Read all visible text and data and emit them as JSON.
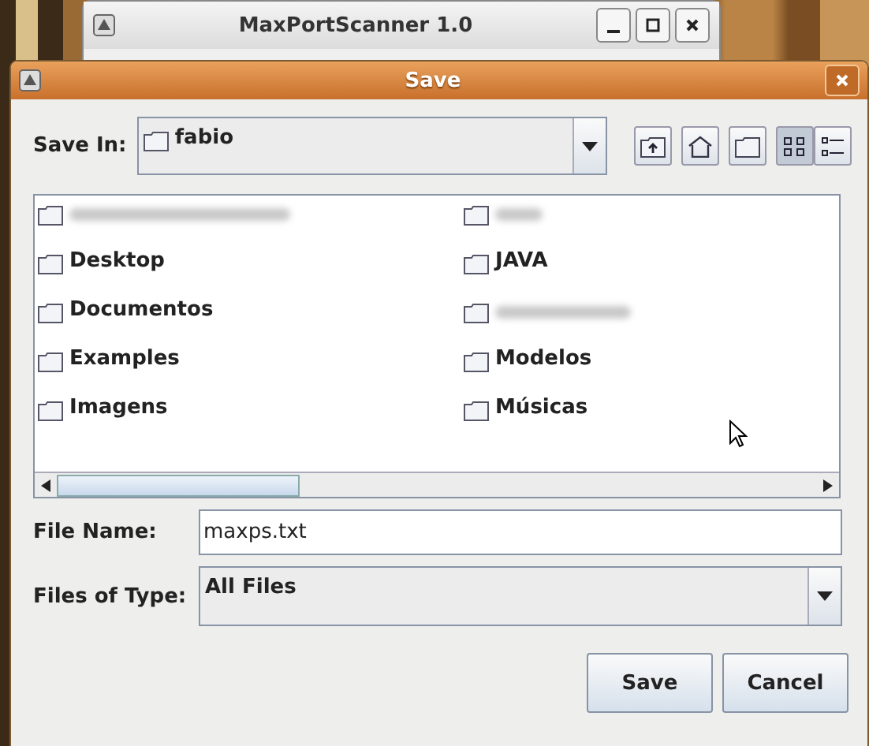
{
  "back_window": {
    "title": "MaxPortScanner 1.0"
  },
  "dialog": {
    "title": "Save",
    "save_in": {
      "label": "Save In:",
      "value": "fabio"
    },
    "toolbar": [
      {
        "kind": "up",
        "selected": false
      },
      {
        "kind": "home",
        "selected": false
      },
      {
        "kind": "new-folder",
        "selected": false
      },
      {
        "kind": "list",
        "selected": true
      },
      {
        "kind": "details",
        "selected": false
      }
    ],
    "files": [
      {
        "kind": "blurred"
      },
      {
        "kind": "folder",
        "label": "Desktop"
      },
      {
        "kind": "folder",
        "label": "Documentos"
      },
      {
        "kind": "folder",
        "label": "Examples"
      },
      {
        "kind": "folder",
        "label": "Imagens"
      },
      {
        "kind": "blurred"
      },
      {
        "kind": "folder",
        "label": "JAVA"
      },
      {
        "kind": "blurred"
      },
      {
        "kind": "folder",
        "label": "Modelos"
      },
      {
        "kind": "folder",
        "label": "Músicas"
      }
    ],
    "file_name": {
      "label": "File Name:",
      "value": "maxps.txt"
    },
    "file_type": {
      "label": "Files of Type:",
      "value": "All Files"
    },
    "buttons": [
      "Save",
      "Cancel"
    ]
  }
}
